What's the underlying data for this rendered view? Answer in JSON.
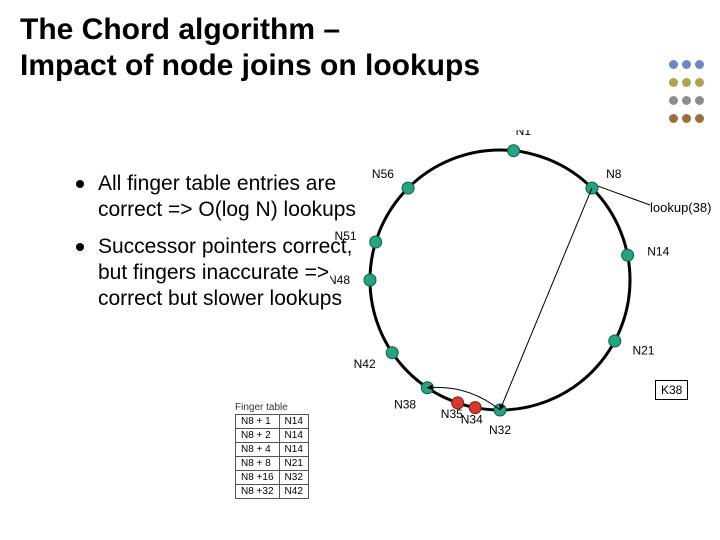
{
  "title_line1": "The Chord algorithm –",
  "title_line2": "Impact of node joins on lookups",
  "bullets": [
    "All finger table entries are correct => O(log N) lookups",
    "Successor pointers correct, but fingers inaccurate => correct but slower lookups"
  ],
  "finger_table": {
    "caption": "Finger table",
    "rows": [
      [
        "N8 + 1",
        "N14"
      ],
      [
        "N8 + 2",
        "N14"
      ],
      [
        "N8 + 4",
        "N14"
      ],
      [
        "N8 + 8",
        "N21"
      ],
      [
        "N8 +16",
        "N32"
      ],
      [
        "N8 +32",
        "N42"
      ]
    ]
  },
  "lookup_label": "lookup(38)",
  "key_label": "K38",
  "nodes": [
    {
      "id": "N1",
      "angle_deg": 84
    },
    {
      "id": "N8",
      "angle_deg": 45
    },
    {
      "id": "N14",
      "angle_deg": 11
    },
    {
      "id": "N21",
      "angle_deg": -28
    },
    {
      "id": "N32",
      "angle_deg": -90
    },
    {
      "id": "N38",
      "angle_deg": -124
    },
    {
      "id": "N42",
      "angle_deg": -146
    },
    {
      "id": "N48",
      "angle_deg": -180
    },
    {
      "id": "N51",
      "angle_deg": -197
    },
    {
      "id": "N56",
      "angle_deg": -225
    }
  ],
  "new_nodes": [
    {
      "id": "N34",
      "angle_deg": -101
    },
    {
      "id": "N35",
      "angle_deg": -109
    }
  ],
  "lookup_path": [
    "N8",
    "N32",
    "N38"
  ],
  "corner_colors": [
    "#6a88c4",
    "#6a88c4",
    "#6a88c4",
    "#b1a24e",
    "#b1a24e",
    "#b1a24e",
    "#8d8d8d",
    "#8d8d8d",
    "#8d8d8d",
    "#9a6f3d",
    "#9a6f3d",
    "#9a6f3d"
  ]
}
